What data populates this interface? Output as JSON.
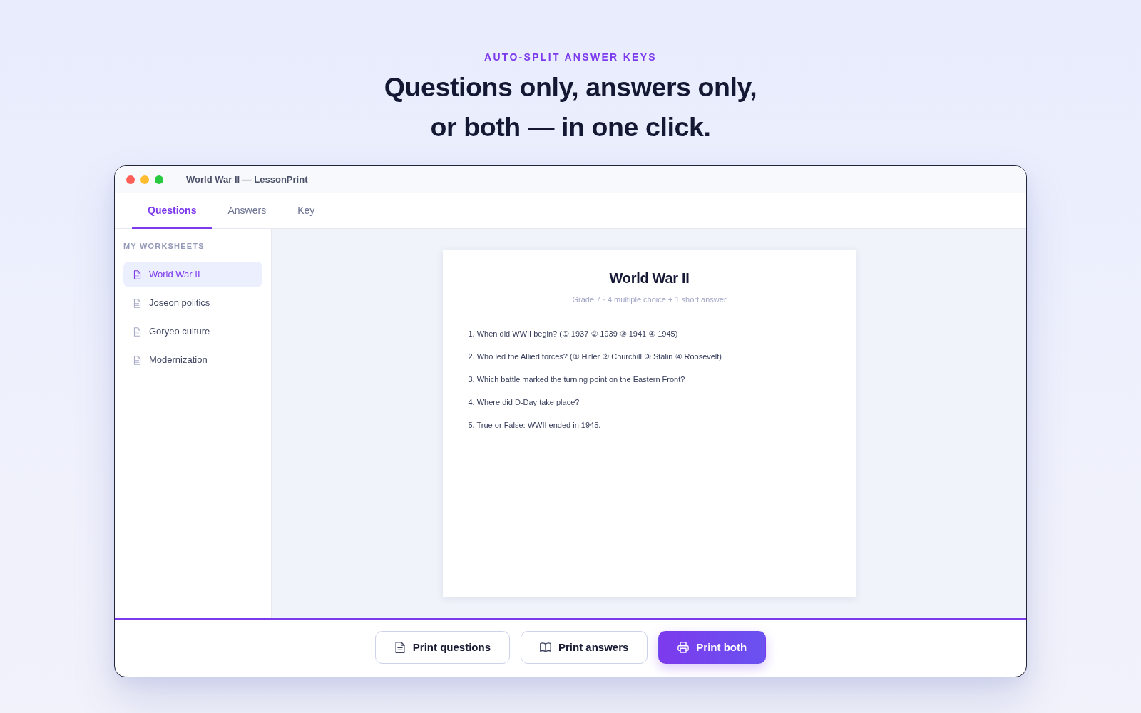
{
  "hero": {
    "eyebrow": "AUTO-SPLIT ANSWER KEYS",
    "headline_lines": [
      "Questions only, answers only,",
      "or both — in one click."
    ]
  },
  "window": {
    "title": "World War II — LessonPrint"
  },
  "tabs": [
    {
      "label": "Questions",
      "selected": true
    },
    {
      "label": "Answers",
      "selected": false
    },
    {
      "label": "Key",
      "selected": false
    }
  ],
  "sidebar": {
    "heading": "MY WORKSHEETS",
    "items": [
      {
        "label": "World War II",
        "selected": true
      },
      {
        "label": "Joseon politics",
        "selected": false
      },
      {
        "label": "Goryeo culture",
        "selected": false
      },
      {
        "label": "Modernization",
        "selected": false
      }
    ]
  },
  "document": {
    "title": "World War II",
    "subtitle": "Grade 7 · 4 multiple choice + 1 short answer",
    "questions": [
      "1. When did WWII begin? (① 1937 ② 1939 ③ 1941 ④ 1945)",
      "2. Who led the Allied forces? (① Hitler ② Churchill ③ Stalin ④ Roosevelt)",
      "3. Which battle marked the turning point on the Eastern Front?",
      "4. Where did D-Day take place?",
      "5. True or False: WWII ended in 1945."
    ]
  },
  "actions": [
    {
      "label": "Print questions",
      "primary": false
    },
    {
      "label": "Print answers",
      "primary": false
    },
    {
      "label": "Print both",
      "primary": true
    }
  ]
}
